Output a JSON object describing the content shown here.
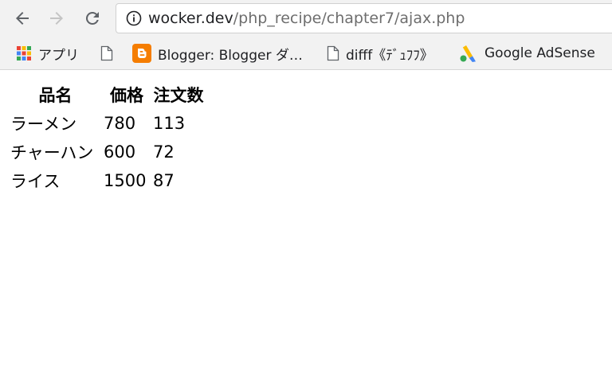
{
  "address_bar": {
    "host": "wocker.dev",
    "path": "/php_recipe/chapter7/ajax.php"
  },
  "bookmarks": [
    {
      "icon": "apps-grid-icon",
      "label": "アプリ"
    },
    {
      "icon": "page-icon",
      "label": ""
    },
    {
      "icon": "blogger-icon",
      "label": "Blogger: Blogger ダ…"
    },
    {
      "icon": "page-icon",
      "label": "difff《ﾃﾞｭﾌﾌ》"
    },
    {
      "icon": "adsense-icon",
      "label": "Google AdSense"
    }
  ],
  "table": {
    "headers": [
      "品名",
      "価格",
      "注文数"
    ],
    "rows": [
      [
        "ラーメン",
        "780",
        "113"
      ],
      [
        "チャーハン",
        "600",
        "72"
      ],
      [
        "ライス",
        "1500",
        "87"
      ]
    ]
  },
  "colors": {
    "chrome_bg": "#f2f2f2",
    "blogger_orange": "#f57d00",
    "adsense_yellow": "#fbbc04",
    "adsense_blue": "#4285f4"
  }
}
